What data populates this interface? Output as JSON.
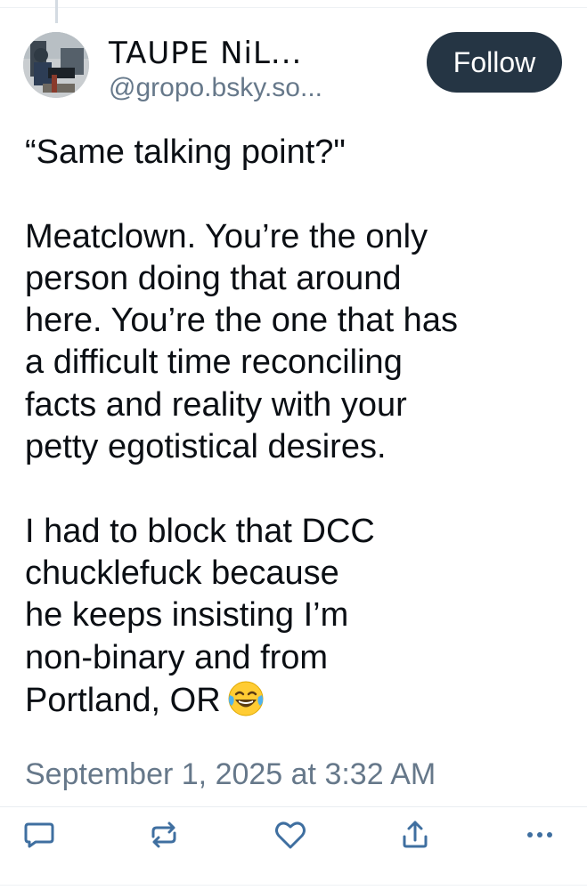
{
  "author": {
    "display_name": "TAUPE NiL...",
    "handle": "@gropo.bsky.so...",
    "avatar_icon": "user-photo-avatar"
  },
  "follow_button": {
    "label": "Follow",
    "color": "#253544"
  },
  "post": {
    "paragraphs": [
      [
        "“Same talking point?\""
      ],
      [
        "Meatclown. You’re the only",
        "person doing that around",
        "here. You’re the one that has",
        "a difficult time reconciling",
        "facts and reality with your",
        "petty egotistical desires."
      ],
      [
        "I had to block that DCC",
        "chucklefuck because",
        "he keeps insisting I’m",
        "non-binary and from",
        "Portland, OR"
      ]
    ],
    "trailing_emoji": "face-with-tears-of-joy-emoji",
    "timestamp": "September 1, 2025 at 3:32 AM"
  },
  "actions": [
    {
      "name": "reply-icon"
    },
    {
      "name": "repost-icon"
    },
    {
      "name": "like-icon"
    },
    {
      "name": "share-icon"
    },
    {
      "name": "more-options-icon"
    }
  ],
  "colors": {
    "text": "#0b0f14",
    "secondary_text": "#66788a",
    "icon": "#3f6fa0"
  }
}
